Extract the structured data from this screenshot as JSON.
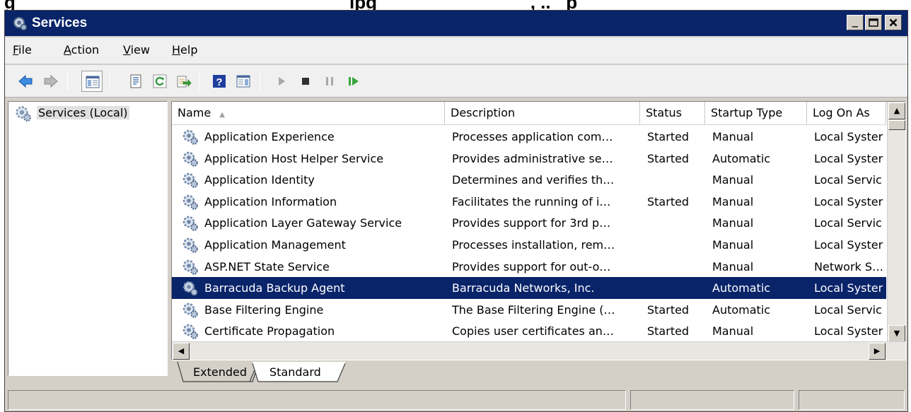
{
  "window": {
    "title": "Services"
  },
  "menu": [
    {
      "accel": "F",
      "rest": "ile"
    },
    {
      "accel": "A",
      "rest": "ction"
    },
    {
      "accel": "V",
      "rest": "iew"
    },
    {
      "accel": "H",
      "rest": "elp"
    }
  ],
  "tree": {
    "root_label": "Services (Local)"
  },
  "columns": [
    "Name",
    "Description",
    "Status",
    "Startup Type",
    "Log On As"
  ],
  "rows": [
    {
      "name": "Application Experience",
      "description": "Processes application com…",
      "status": "Started",
      "startup": "Manual",
      "logon": "Local Syster"
    },
    {
      "name": "Application Host Helper Service",
      "description": "Provides administrative se…",
      "status": "Started",
      "startup": "Automatic",
      "logon": "Local Syster"
    },
    {
      "name": "Application Identity",
      "description": "Determines and verifies th…",
      "status": "",
      "startup": "Manual",
      "logon": "Local Servic"
    },
    {
      "name": "Application Information",
      "description": "Facilitates the running of i…",
      "status": "Started",
      "startup": "Manual",
      "logon": "Local Syster"
    },
    {
      "name": "Application Layer Gateway Service",
      "description": "Provides support for 3rd p…",
      "status": "",
      "startup": "Manual",
      "logon": "Local Servic"
    },
    {
      "name": "Application Management",
      "description": "Processes installation, rem…",
      "status": "",
      "startup": "Manual",
      "logon": "Local Syster"
    },
    {
      "name": "ASP.NET State Service",
      "description": "Provides support for out-o…",
      "status": "",
      "startup": "Manual",
      "logon": "Network S…"
    },
    {
      "name": "Barracuda Backup Agent",
      "description": "Barracuda Networks, Inc.",
      "status": "",
      "startup": "Automatic",
      "logon": "Local Syster"
    },
    {
      "name": "Base Filtering Engine",
      "description": "The Base Filtering Engine (…",
      "status": "Started",
      "startup": "Automatic",
      "logon": "Local Servic"
    },
    {
      "name": "Certificate Propagation",
      "description": "Copies user certificates an…",
      "status": "Started",
      "startup": "Manual",
      "logon": "Local Syster"
    }
  ],
  "selected_row": 7,
  "tabs": [
    {
      "label": "Extended",
      "active": false
    },
    {
      "label": "Standard",
      "active": true
    }
  ],
  "icons": {
    "toolbar": [
      "back-arrow-icon",
      "forward-arrow-icon",
      "console-tree-icon",
      "properties-icon",
      "refresh-icon",
      "export-list-icon",
      "help-icon",
      "show-action-pane-icon",
      "start-service-icon",
      "stop-service-icon",
      "pause-service-icon",
      "resume-service-icon"
    ],
    "service": "gear-icon"
  },
  "colors": {
    "titlebar": "#0a246a",
    "selection": "#0a246a",
    "chrome": "#d4d0c8",
    "start_green": "#3aa53a"
  },
  "caption": {
    "left": "g",
    "bold": "ipg                              , ..   p"
  }
}
